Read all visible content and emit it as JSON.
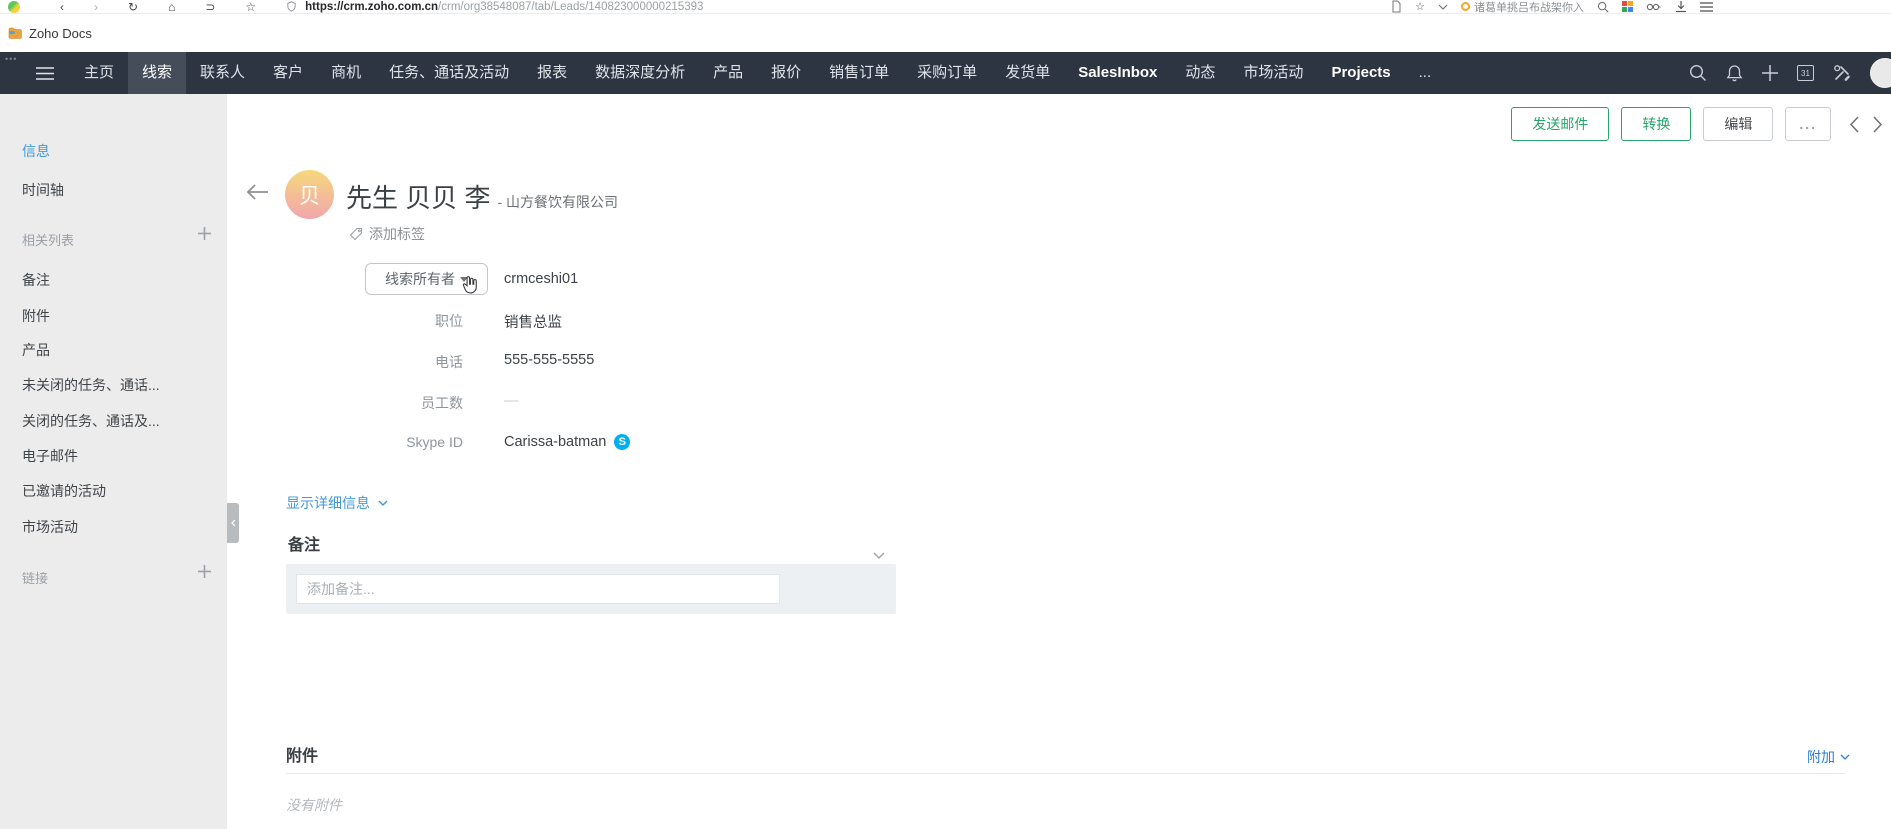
{
  "browser": {
    "url_host": "https://crm.zoho.com.cn",
    "url_path": "/crm/org38548087/tab/Leads/140823000000215393",
    "bookmark_label": "Zoho Docs",
    "promo_text": "诸葛单挑吕布战架你入",
    "icons": {
      "back": "‹",
      "forward": "›",
      "refresh": "↻",
      "home": "⌂",
      "reader": "⊃",
      "star": "☆",
      "bookmark_star": "☆"
    }
  },
  "navbar": {
    "items": [
      {
        "label": "主页"
      },
      {
        "label": "线索",
        "active": true
      },
      {
        "label": "联系人"
      },
      {
        "label": "客户"
      },
      {
        "label": "商机"
      },
      {
        "label": "任务、通话及活动"
      },
      {
        "label": "报表"
      },
      {
        "label": "数据深度分析"
      },
      {
        "label": "产品"
      },
      {
        "label": "报价"
      },
      {
        "label": "销售订单"
      },
      {
        "label": "采购订单"
      },
      {
        "label": "发货单"
      },
      {
        "label": "SalesInbox",
        "bold": true
      },
      {
        "label": "动态"
      },
      {
        "label": "市场活动"
      },
      {
        "label": "Projects",
        "bold": true
      },
      {
        "label": "..."
      }
    ],
    "calendar_day": "31"
  },
  "sidebar": {
    "info_items": [
      {
        "label": "信息",
        "active": true
      },
      {
        "label": "时间轴"
      }
    ],
    "related_header": "相关列表",
    "related_items": [
      "备注",
      "附件",
      "产品",
      "未关闭的任务、通话...",
      "关闭的任务、通话及...",
      "电子邮件",
      "已邀请的活动",
      "市场活动"
    ],
    "links_header": "链接"
  },
  "toolbar": {
    "send_mail": "发送邮件",
    "convert": "转换",
    "edit": "编辑",
    "more": "..."
  },
  "lead": {
    "name": "先生 贝贝 李",
    "company": "- 山方餐饮有限公司",
    "avatar_char": "贝",
    "add_tag": "添加标签",
    "owner_field_label": "线索所有者",
    "owner_value": "crmceshi01",
    "fields": [
      {
        "label": "职位",
        "value": "销售总监"
      },
      {
        "label": "电话",
        "value": "555-555-5555"
      },
      {
        "label": "员工数",
        "value": "—"
      },
      {
        "label": "Skype ID",
        "value": "Carissa-batman"
      }
    ],
    "show_details": "显示详细信息"
  },
  "notes": {
    "heading": "备注",
    "placeholder": "添加备注..."
  },
  "attachments": {
    "heading": "附件",
    "attach_action": "附加",
    "empty_text": "没有附件"
  },
  "colors": {
    "accent_green": "#27a56b",
    "accent_blue": "#3f9ad7",
    "navbar_bg": "#2d3542",
    "sidebar_bg": "#ececec",
    "skype_blue": "#00aff0"
  }
}
